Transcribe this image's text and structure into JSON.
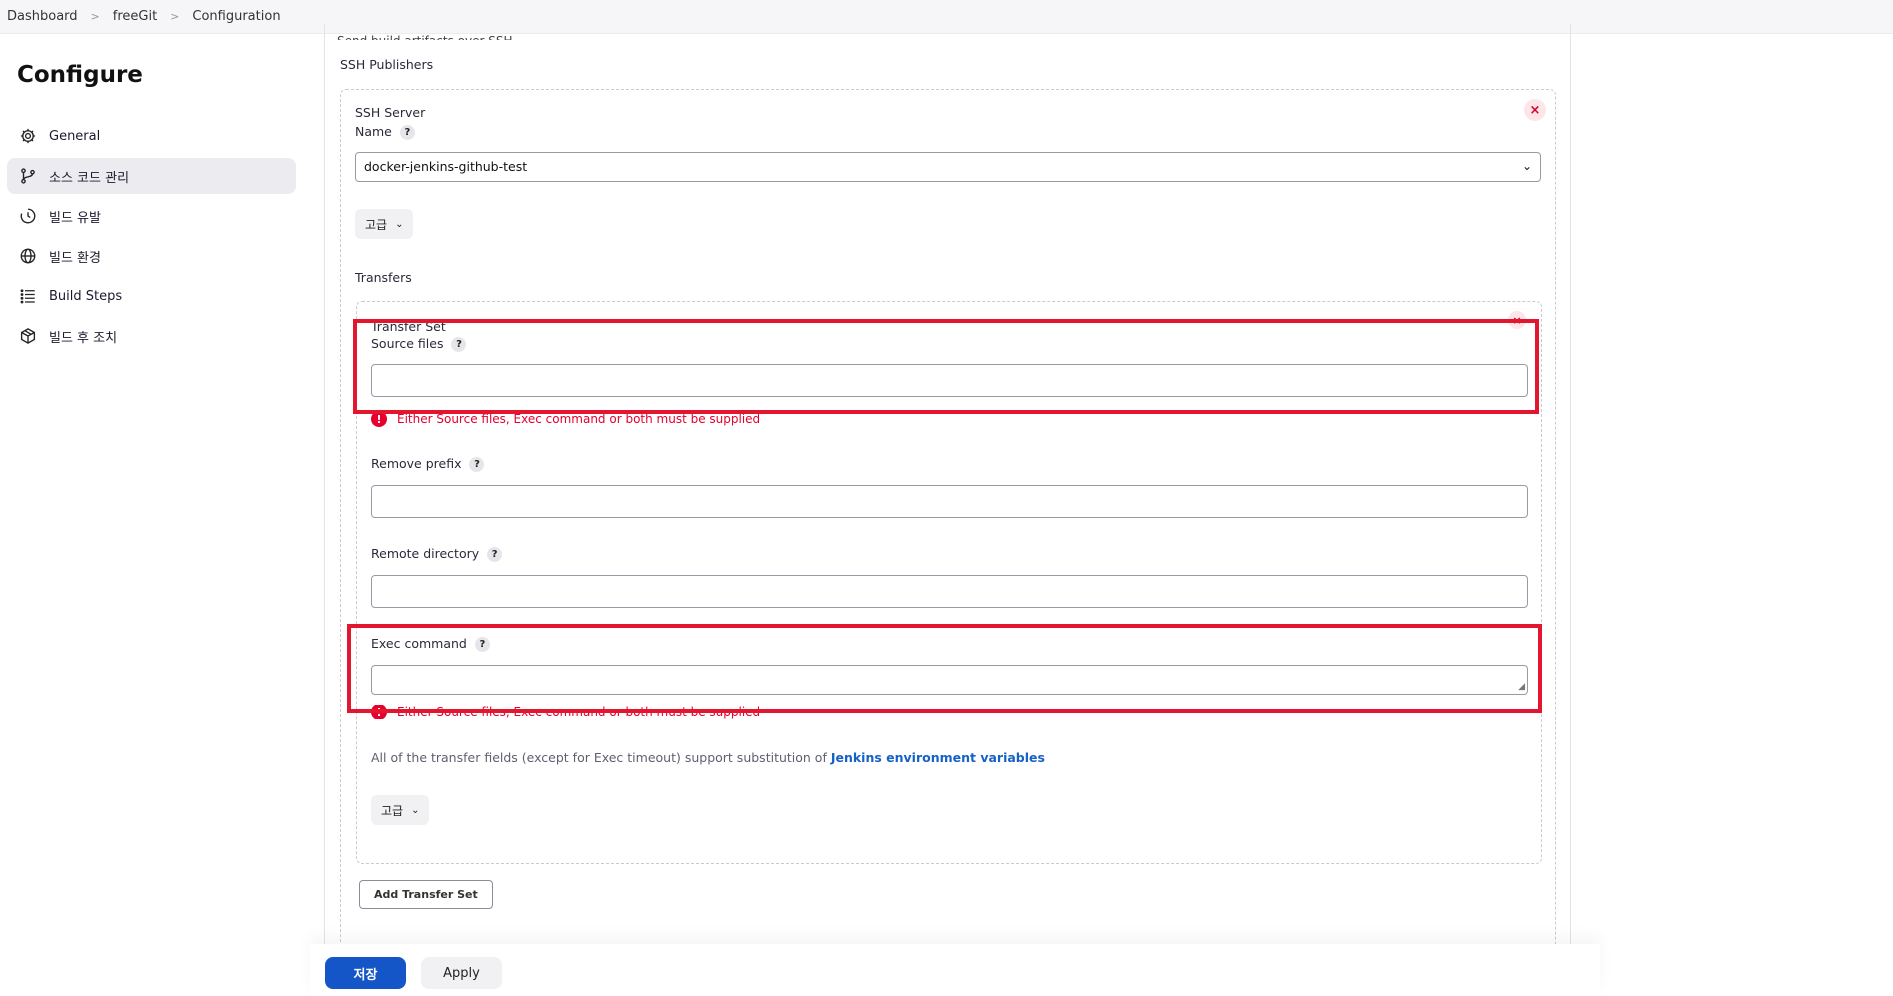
{
  "breadcrumb": [
    "Dashboard",
    "freeGit",
    "Configuration"
  ],
  "sidebar": {
    "title": "Configure",
    "items": [
      {
        "label": "General",
        "icon": "gear-icon"
      },
      {
        "label": "소스 코드 관리",
        "icon": "branch-icon",
        "active": true
      },
      {
        "label": "빌드 유발",
        "icon": "clock-icon"
      },
      {
        "label": "빌드 환경",
        "icon": "globe-icon"
      },
      {
        "label": "Build Steps",
        "icon": "list-icon"
      },
      {
        "label": "빌드 후 조치",
        "icon": "package-icon"
      }
    ]
  },
  "main": {
    "cut_title": "Send build artifacts over SSH",
    "ssh_publishers_label": "SSH Publishers",
    "ssh_server_label": "SSH Server",
    "name_label": "Name",
    "name_value": "docker-jenkins-github-test",
    "advanced_label": "고급",
    "transfers_label": "Transfers",
    "transfer_set_label": "Transfer Set",
    "source_files_label": "Source files",
    "source_files_value": "",
    "error_text": "Either Source files, Exec command or both must be supplied",
    "remove_prefix_label": "Remove prefix",
    "remote_directory_label": "Remote directory",
    "exec_command_label": "Exec command",
    "note_text": "All of the transfer fields (except for Exec timeout) support substitution of ",
    "note_link": "Jenkins environment variables",
    "add_transfer_set_label": "Add Transfer Set",
    "help_glyph": "?",
    "close_glyph": "×"
  },
  "footer": {
    "save_label": "저장",
    "apply_label": "Apply"
  },
  "colors": {
    "accent": "#1456c8",
    "error": "#e6002e",
    "highlight": "#e2162f"
  }
}
